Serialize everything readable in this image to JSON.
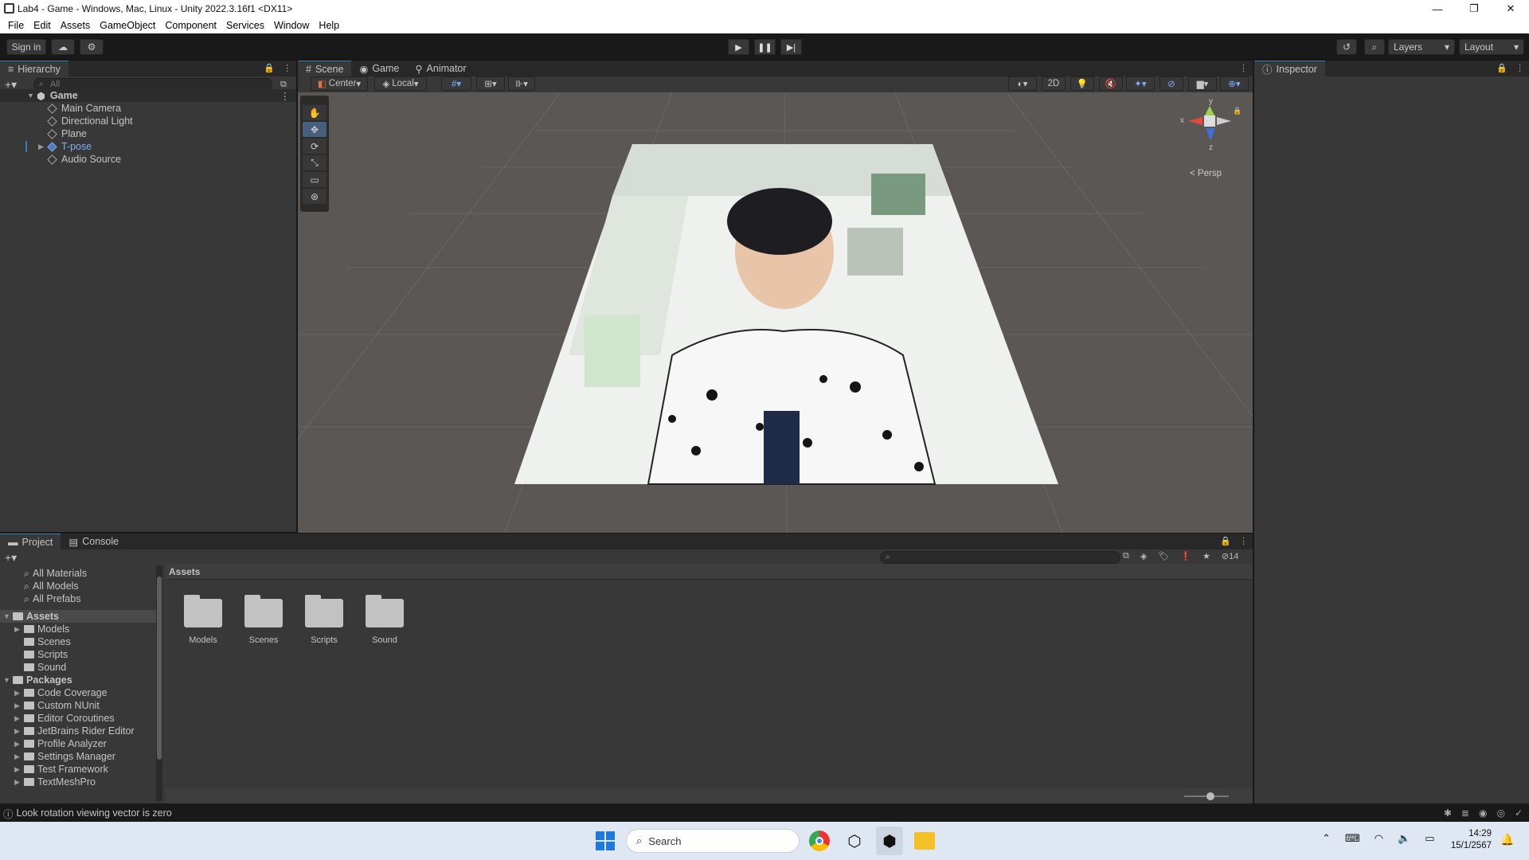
{
  "window": {
    "title": "Lab4 - Game - Windows, Mac, Linux - Unity 2022.3.16f1 <DX11>",
    "minimize": "—",
    "maximize": "❐",
    "close": "✕"
  },
  "menu": [
    "File",
    "Edit",
    "Assets",
    "GameObject",
    "Component",
    "Services",
    "Window",
    "Help"
  ],
  "toolbar": {
    "sign_in": "Sign in",
    "layers": "Layers",
    "layout": "Layout"
  },
  "hierarchy": {
    "tab": "Hierarchy",
    "search_placeholder": "All",
    "root": "Game",
    "items": [
      "Main Camera",
      "Directional Light",
      "Plane",
      "T-pose",
      "Audio Source"
    ]
  },
  "scene_tabs": {
    "scene": "Scene",
    "game": "Game",
    "animator": "Animator"
  },
  "scene_toolbar": {
    "pivot": "Center",
    "space": "Local",
    "mode_2d": "2D"
  },
  "gizmo": {
    "persp": "Persp",
    "y": "y",
    "x": "x",
    "z": "z"
  },
  "inspector": {
    "tab": "Inspector"
  },
  "project": {
    "tab_project": "Project",
    "tab_console": "Console",
    "hidden_count": "14",
    "favorites": [
      "All Materials",
      "All Models",
      "All Prefabs"
    ],
    "assets_label": "Assets",
    "asset_folders": [
      "Models",
      "Scenes",
      "Scripts",
      "Sound"
    ],
    "packages_label": "Packages",
    "packages": [
      "Code Coverage",
      "Custom NUnit",
      "Editor Coroutines",
      "JetBrains Rider Editor",
      "Profile Analyzer",
      "Settings Manager",
      "Test Framework",
      "TextMeshPro"
    ],
    "breadcrumb": "Assets",
    "grid_folders": [
      "Models",
      "Scenes",
      "Scripts",
      "Sound"
    ]
  },
  "status": {
    "message": "Look rotation viewing vector is zero"
  },
  "taskbar": {
    "search": "Search",
    "time": "14:29",
    "date": "15/1/2567"
  }
}
